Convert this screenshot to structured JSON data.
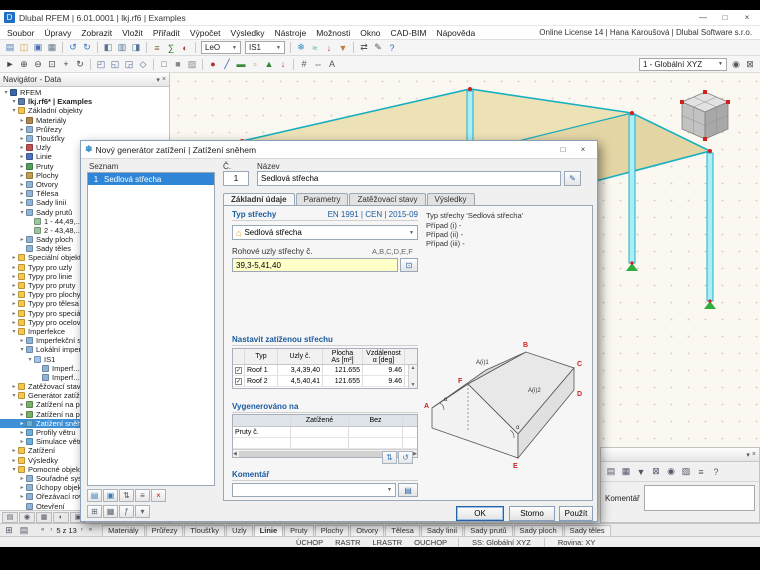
{
  "colors": {
    "selection": "#3d8fd6",
    "section_header": "#1a5a9e",
    "viewport_bg": "#fbf8f1",
    "roof_fill": "#ede1b6",
    "column_fill": "#aaeef8",
    "support_green": "#2fae3f",
    "node_red": "#e01818"
  },
  "window": {
    "title": "Dlubal RFEM | 6.01.0001 | lkj.rf6 | Examples",
    "minimize": "—",
    "maximize": "□",
    "close": "×"
  },
  "menu": {
    "items": [
      "Soubor",
      "Úpravy",
      "Zobrazit",
      "Vložit",
      "Přiřadit",
      "Výpočet",
      "Výsledky",
      "Nástroje",
      "Možnosti",
      "Okno",
      "CAD-BIM",
      "Nápověda"
    ],
    "license": "Online License 14 | Hana Karoušová | Dlubal Software s.r.o."
  },
  "toolbar1": [
    {
      "n": "new-model-icon",
      "g": "▤",
      "c": "#4a78c0"
    },
    {
      "n": "open-model-icon",
      "g": "◫",
      "c": "#d9a23c"
    },
    {
      "n": "save-model-icon",
      "g": "▣",
      "c": "#4a6fae"
    },
    {
      "n": "print-icon",
      "g": "▦",
      "c": "#667788"
    },
    {
      "sep": true
    },
    {
      "n": "undo-icon",
      "g": "↺",
      "c": "#2f6fc0"
    },
    {
      "n": "redo-icon",
      "g": "↻",
      "c": "#2f6fc0"
    },
    {
      "sep": true
    },
    {
      "n": "data-navigator-icon",
      "g": "◧",
      "c": "#557799"
    },
    {
      "n": "tables-icon",
      "g": "▥",
      "c": "#557799"
    },
    {
      "n": "panel-icon",
      "g": "◨",
      "c": "#557799"
    },
    {
      "sep": true
    },
    {
      "n": "load-cases-icon",
      "g": "≡",
      "c": "#886644"
    },
    {
      "n": "calculate-icon",
      "g": "∑",
      "c": "#2a7a2a"
    },
    {
      "n": "results-icon",
      "g": "◐",
      "c": "#b04040"
    },
    {
      "sep": true
    },
    {
      "combo": "LeO",
      "n": "load-case-combo"
    },
    {
      "combo": "IS1",
      "n": "imperfection-case-combo"
    },
    {
      "sep": true
    },
    {
      "n": "snow-load-generator-icon",
      "g": "❄",
      "c": "#2a8ac0"
    },
    {
      "n": "wind-load-icon",
      "g": "≈",
      "c": "#3aa0a0"
    },
    {
      "n": "member-load-icon",
      "g": "↓",
      "c": "#c04040"
    },
    {
      "n": "surface-load-icon",
      "g": "▼",
      "c": "#c08040"
    },
    {
      "sep": true
    },
    {
      "n": "measure-icon",
      "g": "⇄",
      "c": "#555555"
    },
    {
      "n": "notes-icon",
      "g": "✎",
      "c": "#555555"
    },
    {
      "n": "help-icon",
      "g": "?",
      "c": "#2a6ac0"
    }
  ],
  "toolbar2": [
    {
      "n": "select-arrow-icon",
      "g": "►",
      "c": "#444444"
    },
    {
      "n": "zoom-in-icon",
      "g": "⊕",
      "c": "#444444"
    },
    {
      "n": "zoom-out-icon",
      "g": "⊖",
      "c": "#444444"
    },
    {
      "n": "zoom-window-icon",
      "g": "⊡",
      "c": "#444444"
    },
    {
      "n": "pan-icon",
      "g": "+",
      "c": "#444444"
    },
    {
      "n": "rotate-view-icon",
      "g": "↻",
      "c": "#444444"
    },
    {
      "sep": true
    },
    {
      "n": "view-xy-icon",
      "g": "◰",
      "c": "#556699"
    },
    {
      "n": "view-xz-icon",
      "g": "◱",
      "c": "#556699"
    },
    {
      "n": "view-yz-icon",
      "g": "◲",
      "c": "#556699"
    },
    {
      "n": "isometric-view-icon",
      "g": "◇",
      "c": "#556699"
    },
    {
      "sep": true
    },
    {
      "n": "wireframe-icon",
      "g": "□",
      "c": "#666666"
    },
    {
      "n": "solid-view-icon",
      "g": "■",
      "c": "#888888"
    },
    {
      "n": "transparent-view-icon",
      "g": "▨",
      "c": "#888888"
    },
    {
      "sep": true
    },
    {
      "n": "show-nodes-icon",
      "g": "●",
      "c": "#b03030"
    },
    {
      "n": "show-lines-icon",
      "g": "╱",
      "c": "#3060b0"
    },
    {
      "n": "show-members-icon",
      "g": "▬",
      "c": "#3a8a3a"
    },
    {
      "n": "show-surfaces-icon",
      "g": "▫",
      "c": "#c09030"
    },
    {
      "n": "show-supports-icon",
      "g": "▲",
      "c": "#2a8a2a"
    },
    {
      "n": "show-loads-icon",
      "g": "↓",
      "c": "#c03030"
    },
    {
      "sep": true
    },
    {
      "n": "numbering-icon",
      "g": "#",
      "c": "#555555"
    },
    {
      "n": "dimensions-icon",
      "g": "⇔",
      "c": "#555555"
    },
    {
      "n": "text-annotation-icon",
      "g": "A",
      "c": "#555555"
    },
    {
      "spacer": true
    },
    {
      "combo": "1 - Globální XYZ",
      "n": "visibility-combo",
      "w": 88
    },
    {
      "n": "user-view-icon",
      "g": "◉",
      "c": "#555555"
    },
    {
      "n": "clip-plane-icon",
      "g": "⊠",
      "c": "#555555"
    }
  ],
  "navigator": {
    "title": "Navigátor - Data",
    "footer_tabs": [
      {
        "n": "nav-tab-data",
        "g": "▤"
      },
      {
        "n": "nav-tab-display",
        "g": "◉"
      },
      {
        "n": "nav-tab-views",
        "g": "▦"
      },
      {
        "n": "nav-tab-results",
        "g": "◐"
      },
      {
        "n": "nav-tab-templates",
        "g": "▣"
      }
    ],
    "tree": [
      {
        "t": "RFEM",
        "l": 0,
        "e": "▾",
        "c": "#3a66a8"
      },
      {
        "t": "lkj.rf6* | Examples",
        "l": 1,
        "e": "▾",
        "c": "#5a7fae",
        "b": 1
      },
      {
        "t": "Základní objekty",
        "l": 1,
        "e": "▾",
        "c": "#f6c74a"
      },
      {
        "t": "Materiály",
        "l": 2,
        "e": "▸",
        "c": "#b0884a"
      },
      {
        "t": "Průřezy",
        "l": 2,
        "e": "▸",
        "c": "#8fb4d8"
      },
      {
        "t": "Tloušťky",
        "l": 2,
        "e": "▸",
        "c": "#8fb4d8"
      },
      {
        "t": "Uzly",
        "l": 2,
        "e": "▸",
        "c": "#c05050"
      },
      {
        "t": "Linie",
        "l": 2,
        "e": "▸",
        "c": "#5070c0"
      },
      {
        "t": "Pruty",
        "l": 2,
        "e": "▸",
        "c": "#50a060"
      },
      {
        "t": "Plochy",
        "l": 2,
        "e": "▸",
        "c": "#c0a050"
      },
      {
        "t": "Otvory",
        "l": 2,
        "e": "▸",
        "c": "#8fb4d8"
      },
      {
        "t": "Tělesa",
        "l": 2,
        "e": "▸",
        "c": "#8fb4d8"
      },
      {
        "t": "Sady linií",
        "l": 2,
        "e": "▸",
        "c": "#8fb4d8"
      },
      {
        "t": "Sady prutů",
        "l": 2,
        "e": "▾",
        "c": "#8fb4d8"
      },
      {
        "t": "1 - 44,49,...",
        "l": 3,
        "e": "",
        "c": "#9fc49f"
      },
      {
        "t": "2 - 43,48,...",
        "l": 3,
        "e": "",
        "c": "#9fc49f"
      },
      {
        "t": "Sady ploch",
        "l": 2,
        "e": "▸",
        "c": "#8fb4d8"
      },
      {
        "t": "Sady těles",
        "l": 2,
        "e": "",
        "c": "#8fb4d8"
      },
      {
        "t": "Speciální objekty",
        "l": 1,
        "e": "▸",
        "c": "#f6c74a"
      },
      {
        "t": "Typy pro uzly",
        "l": 1,
        "e": "▸",
        "c": "#f6c74a"
      },
      {
        "t": "Typy pro linie",
        "l": 1,
        "e": "▸",
        "c": "#f6c74a"
      },
      {
        "t": "Typy pro pruty",
        "l": 1,
        "e": "▸",
        "c": "#f6c74a"
      },
      {
        "t": "Typy pro plochy",
        "l": 1,
        "e": "▸",
        "c": "#f6c74a"
      },
      {
        "t": "Typy pro tělesa",
        "l": 1,
        "e": "▸",
        "c": "#f6c74a"
      },
      {
        "t": "Typy pro speciál...",
        "l": 1,
        "e": "▸",
        "c": "#f6c74a"
      },
      {
        "t": "Typy pro ocelové...",
        "l": 1,
        "e": "▸",
        "c": "#f6c74a"
      },
      {
        "t": "Imperfekce",
        "l": 1,
        "e": "▾",
        "c": "#f6c74a"
      },
      {
        "t": "Imperfekční sy...",
        "l": 2,
        "e": "▸",
        "c": "#8fb4d8"
      },
      {
        "t": "Lokální imperf...",
        "l": 2,
        "e": "▾",
        "c": "#8fb4d8"
      },
      {
        "t": "IS1",
        "l": 3,
        "e": "▾",
        "c": "#9fc4e8"
      },
      {
        "t": "Imperf...",
        "l": 4,
        "e": "",
        "c": "#8fb4d8"
      },
      {
        "t": "Imperf...",
        "l": 4,
        "e": "",
        "c": "#8fb4d8"
      },
      {
        "t": "Zatěžovací stavy...",
        "l": 1,
        "e": "▸",
        "c": "#f6c74a"
      },
      {
        "t": "Generátor zatíž...",
        "l": 1,
        "e": "▾",
        "c": "#f6c74a"
      },
      {
        "t": "Zatížení na pr...",
        "l": 2,
        "e": "▸",
        "c": "#7ab06a"
      },
      {
        "t": "Zatížení na pl...",
        "l": 2,
        "e": "▸",
        "c": "#7ab06a"
      },
      {
        "t": "Zatížení sněhem",
        "l": 2,
        "e": "▸",
        "c": "#6ab0d8",
        "s": 1
      },
      {
        "t": "Profily větru",
        "l": 2,
        "e": "▸",
        "c": "#6ab0d8"
      },
      {
        "t": "Simulace větru...",
        "l": 2,
        "e": "▸",
        "c": "#6ab0d8"
      },
      {
        "t": "Zatížení",
        "l": 1,
        "e": "▸",
        "c": "#f6c74a"
      },
      {
        "t": "Výsledky",
        "l": 1,
        "e": "▸",
        "c": "#f6c74a"
      },
      {
        "t": "Pomocné objekty",
        "l": 1,
        "e": "▾",
        "c": "#f6c74a"
      },
      {
        "t": "Souřadné sys...",
        "l": 2,
        "e": "▸",
        "c": "#8fb4d8"
      },
      {
        "t": "Úchopy objek...",
        "l": 2,
        "e": "▸",
        "c": "#8fb4d8"
      },
      {
        "t": "Ořezávací rov...",
        "l": 2,
        "e": "▸",
        "c": "#8fb4d8"
      },
      {
        "t": "Otevření",
        "l": 2,
        "e": "",
        "c": "#8fb4d8"
      }
    ]
  },
  "right_panel": {
    "comment_label": "Komentář",
    "tools": [
      {
        "n": "panel-display-icon",
        "g": "▤"
      },
      {
        "n": "panel-views-icon",
        "g": "▦"
      },
      {
        "n": "panel-filter-icon",
        "g": "▼"
      },
      {
        "n": "panel-clip-icon",
        "g": "⊠"
      },
      {
        "n": "panel-visibility-icon",
        "g": "◉"
      },
      {
        "n": "panel-colors-icon",
        "g": "▨"
      },
      {
        "n": "panel-settings-icon",
        "g": "≡"
      },
      {
        "n": "panel-help-icon",
        "g": "?"
      }
    ]
  },
  "dialog": {
    "title": "Nový generátor zatížení | Zatížení sněhem",
    "maximize": "□",
    "close": "×",
    "seznam_label": "Seznam",
    "list": [
      {
        "no": "1",
        "label": "Sedlová střecha",
        "selected": true
      }
    ],
    "list_tools": [
      {
        "n": "list-new-button",
        "g": "▤",
        "c": "#3a7ac0"
      },
      {
        "n": "list-copy-button",
        "g": "▣",
        "c": "#3a7ac0"
      },
      {
        "n": "list-renumber-button",
        "g": "⇅",
        "c": "#555555"
      },
      {
        "n": "list-sort-button",
        "g": "≡",
        "c": "#555555"
      },
      {
        "n": "list-delete-button",
        "g": "×",
        "c": "#c02020"
      }
    ],
    "no_label": "Č.",
    "no_value": "1",
    "name_label": "Název",
    "name_value": "Sedlová střecha",
    "tabs": [
      "Základní údaje",
      "Parametry",
      "Zatěžovací stavy",
      "Výsledky"
    ],
    "active_tab": 0,
    "sec_roof_type": "Typ střechy",
    "code": "EN 1991 | CEN | 2015-09",
    "roof_type_value": "Sedlová střecha",
    "corner_label": "Rohové uzly střechy č.",
    "corner_hint": "A,B,C,D,E,F",
    "corner_value": "39,3-5,41,40",
    "sec_set_roof": "Nastavit zatíženou střechu",
    "roof_table": {
      "h1": [
        "",
        "Typ",
        "Uzly č.",
        "Plocha",
        "Vzdálenost"
      ],
      "h2": [
        "",
        "",
        "",
        "As [m²]",
        "α [deg]"
      ],
      "rows": [
        {
          "check": true,
          "c": [
            "Roof 1",
            "3,4,39,40",
            "121.655",
            "9.46"
          ]
        },
        {
          "check": true,
          "c": [
            "Roof 2",
            "4,5,40,41",
            "121.655",
            "9.46"
          ]
        }
      ]
    },
    "sec_generated": "Vygenerováno na",
    "gen_table": {
      "headers": [
        "",
        "Zatížené",
        "Bez"
      ],
      "rows": [
        [
          "Pruty č.",
          "",
          ""
        ],
        [
          "",
          "",
          ""
        ]
      ]
    },
    "table_tools": [
      {
        "n": "apply-selection-button",
        "g": "⇅",
        "c": "#3a7ac0"
      },
      {
        "n": "reset-selection-button",
        "g": "↺",
        "c": "#3a7ac0"
      }
    ],
    "sec_comment": "Komentář",
    "comment_value": "",
    "info": [
      "Typ střechy 'Sedlová střecha'",
      "Případ (i) -",
      "Případ (ii) -",
      "Případ (iii) -"
    ],
    "sketch": {
      "corners": [
        "A",
        "B",
        "C",
        "D",
        "E",
        "F"
      ],
      "dims": [
        "A(i)1",
        "A(i)2",
        "α",
        "α"
      ]
    },
    "bottom_tools": [
      {
        "n": "dialog-tables-button",
        "g": "⊞",
        "c": "#556677"
      },
      {
        "n": "dialog-grid-button",
        "g": "▦",
        "c": "#556677"
      },
      {
        "n": "dialog-units-button",
        "g": "ƒ",
        "c": "#556677"
      },
      {
        "n": "dialog-info-button",
        "g": "▾",
        "c": "#556677"
      }
    ],
    "buttons": {
      "ok": "OK",
      "cancel": "Storno",
      "apply": "Použít"
    }
  },
  "bottom_tabs": {
    "left_tools": [
      {
        "n": "table-manager-icon",
        "g": "⊞"
      },
      {
        "n": "bottom-navigator-icon",
        "g": "▤"
      }
    ],
    "pager_first": "«",
    "pager_prev": "‹",
    "pager_label": "5 z 13",
    "pager_next": "›",
    "pager_last": "»",
    "tabs": [
      "Materiály",
      "Průřezy",
      "Tloušťky",
      "Uzly",
      "Linie",
      "Pruty",
      "Plochy",
      "Otvory",
      "Tělesa",
      "Sady linií",
      "Sady prutů",
      "Sady ploch",
      "Sady těles"
    ],
    "active_index": 4
  },
  "statusbar": {
    "toggles": [
      "ÚCHOP",
      "RASTR",
      "LRASTR",
      "OUCHOP"
    ],
    "coord_system": "SS: Globální XYZ",
    "plane": "Rovina: XY"
  }
}
